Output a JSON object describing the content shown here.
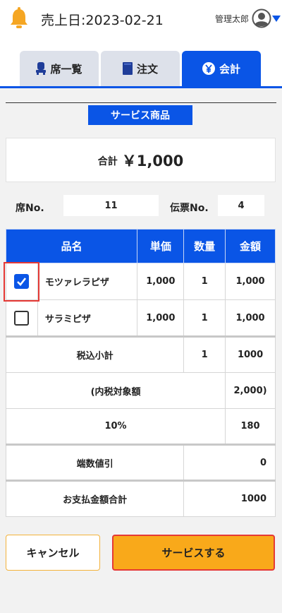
{
  "header": {
    "sales_date_label": "売上日:2023-02-21",
    "user_name": "管理太郎"
  },
  "tabs": [
    {
      "label": "席一覧",
      "icon": "chair-icon",
      "active": false
    },
    {
      "label": "注文",
      "icon": "book-icon",
      "active": false
    },
    {
      "label": "会計",
      "icon": "yen-icon",
      "active": true
    }
  ],
  "section_title": "サービス商品",
  "total": {
    "label": "合計",
    "value": "￥1,000"
  },
  "seat": {
    "label": "席No.",
    "value": "11"
  },
  "slip": {
    "label": "伝票No.",
    "value": "4"
  },
  "table": {
    "headers": {
      "name": "品名",
      "unit_price": "単価",
      "quantity": "数量",
      "amount": "金額"
    },
    "items": [
      {
        "checked": true,
        "name": "モツァレラピザ",
        "unit_price": "1,000",
        "quantity": "1",
        "amount": "1,000"
      },
      {
        "checked": false,
        "name": "サラミピザ",
        "unit_price": "1,000",
        "quantity": "1",
        "amount": "1,000"
      }
    ],
    "summary": {
      "subtotal_label": "税込小計",
      "subtotal_qty": "1",
      "subtotal_amount": "1000",
      "tax_base_label": "(内税対象額",
      "tax_base_amount": "2,000)",
      "tax_rate_label": "10%",
      "tax_amount": "180",
      "rounding_label": "端数値引",
      "rounding_amount": "0",
      "payment_label": "お支払金額合計",
      "payment_amount": "1000"
    }
  },
  "buttons": {
    "cancel": "キャンセル",
    "service": "サービスする"
  },
  "colors": {
    "primary": "#0a55e6",
    "accent": "#f9a91a",
    "highlight": "#e53935",
    "bell": "#f5a623"
  }
}
